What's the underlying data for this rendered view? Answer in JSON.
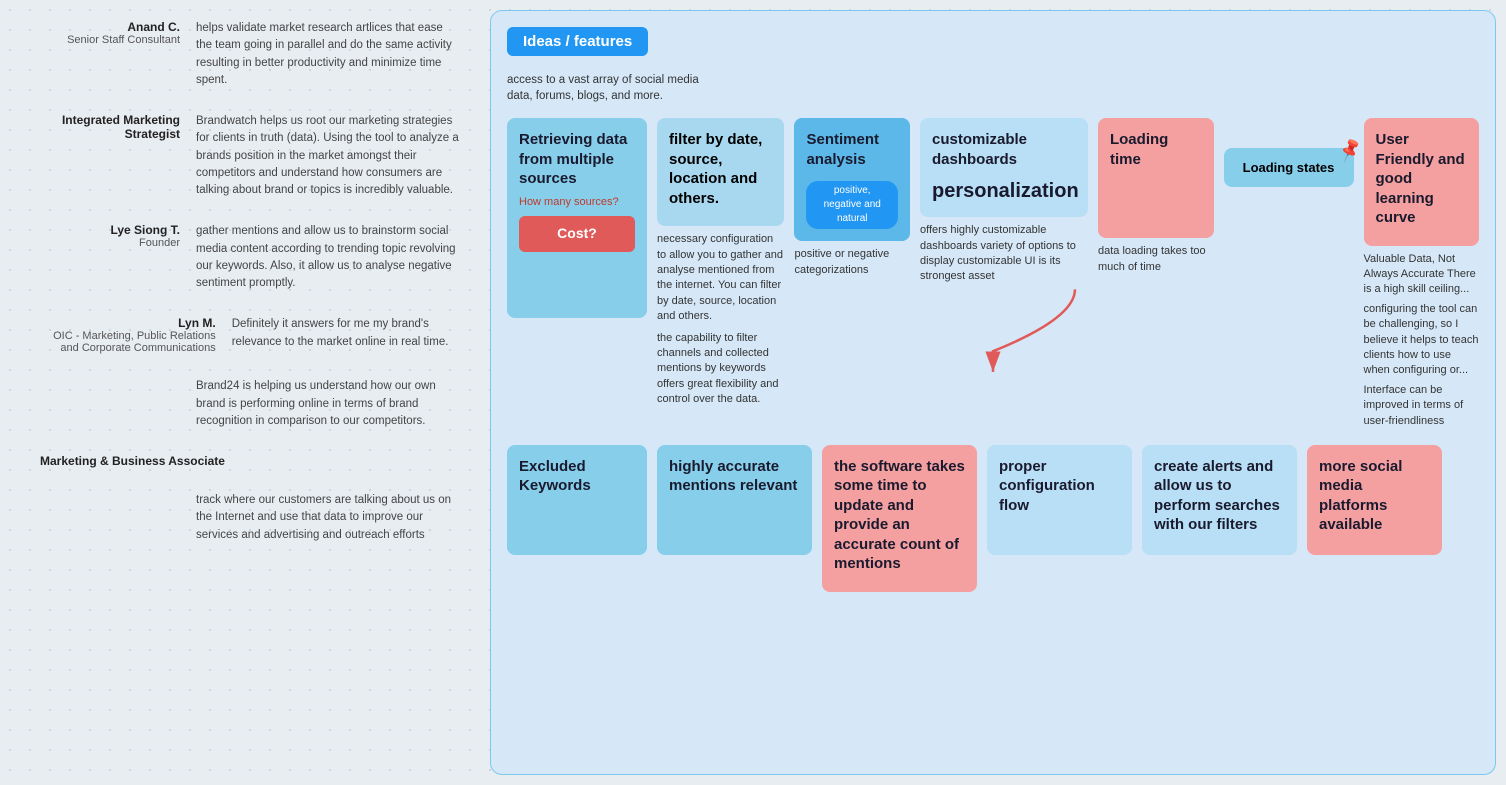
{
  "left_panel": {
    "reviews": [
      {
        "name": "Anand C.",
        "role": "Senior Staff Consultant",
        "text": "helps validate market research artlices that ease the team going in parallel and do the same activity resulting in better productivity and minimize time spent."
      },
      {
        "name": "Integrated Marketing Strategist",
        "role": "",
        "text": "Brandwatch helps us root our marketing strategies for clients in truth (data). Using the tool to analyze a brands position in the market amongst their competitors and understand how consumers are talking about brand or topics is incredibly valuable."
      },
      {
        "name": "Lye Siong T.",
        "role": "Founder",
        "text": "gather mentions and allow us to brainstorm social media content according to trending topic revolving our keywords. Also, it allow us to analyse negative sentiment promptly."
      },
      {
        "name": "Lyn M.",
        "role": "OIC - Marketing, Public Relations and Corporate Communications",
        "text": "Definitely it answers for me my brand's relevance to the market online in real time."
      },
      {
        "name": "",
        "role": "",
        "text": "Brand24 is helping us understand how our own brand is performing online in terms of brand recognition in comparison to our competitors."
      },
      {
        "name": "Marketing & Business Associate",
        "role": "",
        "text": ""
      },
      {
        "name": "",
        "role": "",
        "text": "track where our customers are talking about us on the Internet and use that data to improve our services and advertising and outreach efforts"
      }
    ]
  },
  "canvas": {
    "title": "Ideas / features",
    "intro_text": "access to a vast array of social media data, forums, blogs, and more.",
    "cards_row1": [
      {
        "id": "retrieving-data",
        "title": "Retrieving data from multiple sources",
        "subtitle": "How many sources?",
        "cost_label": "Cost?",
        "color": "blue-light"
      },
      {
        "id": "filter-by-date",
        "title": "filter by date, source, location and others.",
        "body": "necessary configuration to allow you to gather and analyse mentioned from the internet. You can filter by date, source, location and others.\n\nthe capability to filter channels and collected mentions by keywords offers great flexibility and control over the data.",
        "color": "white"
      },
      {
        "id": "sentiment-analysis",
        "title": "Sentiment analysis",
        "badge": "positive, negative and natural",
        "body": "positive or negative categorizations",
        "color": "blue-mid"
      },
      {
        "id": "customizable-dashboards",
        "title": "customizable dashboards",
        "personalization": "personalization",
        "body": "offers highly customizable dashboards variety of options to display customizable UI is its strongest asset",
        "color": "blue-pale"
      },
      {
        "id": "loading-time",
        "title": "Loading time",
        "body": "data loading takes too much of time",
        "color": "pink"
      },
      {
        "id": "user-friendly",
        "title": "User Friendly and good learning curve",
        "body": "Valuable Data, Not Always Accurate There is a high skill ceiling...\nconfiguring the tool can be challenging, so I believe it helps to teach clients how to use when configuring or...\nInterface can be improved in terms of user-friendliness",
        "color": "blue-light"
      }
    ],
    "loading_states": {
      "label": "Loading states"
    },
    "cards_row2": [
      {
        "id": "excluded-keywords",
        "title": "Excluded Keywords",
        "color": "blue-light"
      },
      {
        "id": "highly-accurate",
        "title": "highly accurate mentions relevant",
        "color": "blue-light"
      },
      {
        "id": "software-takes-time",
        "title": "the software takes some time to update and provide an accurate count of mentions",
        "color": "pink"
      },
      {
        "id": "proper-configuration",
        "title": "proper configuration flow",
        "color": "blue-pale"
      },
      {
        "id": "create-alerts",
        "title": "create alerts and allow us to perform searches with our filters",
        "color": "blue-pale"
      },
      {
        "id": "more-social-media",
        "title": "more social media platforms available",
        "color": "pink"
      }
    ]
  }
}
